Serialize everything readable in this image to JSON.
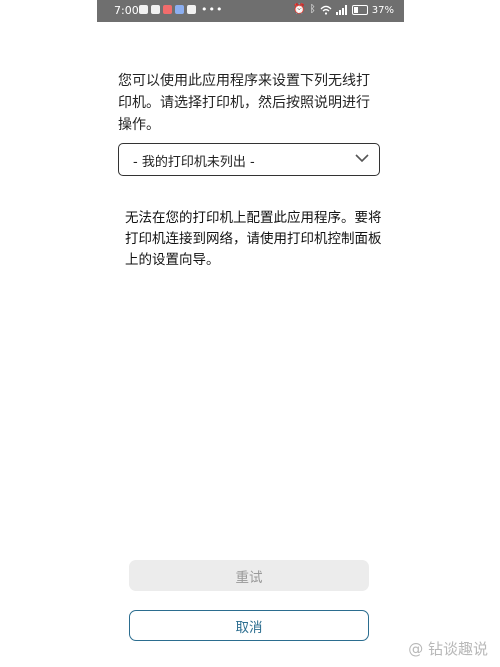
{
  "status_bar": {
    "time": "7:00",
    "dots": "•••",
    "battery_percent": "37%",
    "battery_level": 0.37,
    "left_icons": [
      "app-icon-1",
      "chat-icon",
      "red-app-icon",
      "blue-app-icon",
      "layers-icon"
    ],
    "right_icons": [
      "alarm-icon",
      "bluetooth-icon",
      "wifi-icon",
      "signal-icon",
      "battery-icon"
    ]
  },
  "intro_text": "您可以使用此应用程序来设置下列无线打印机。请选择打印机，然后按照说明进行操作。",
  "printer_select": {
    "selected": "- 我的打印机未列出 -"
  },
  "notice_text": "无法在您的打印机上配置此应用程序。要将打印机连接到网络，请使用打印机控制面板上的设置向导。",
  "buttons": {
    "retry": "重试",
    "cancel": "取消"
  },
  "watermark": "@ 钻谈趣说"
}
